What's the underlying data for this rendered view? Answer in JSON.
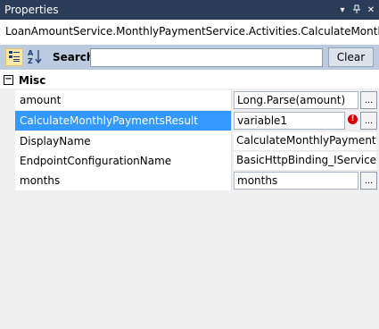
{
  "window": {
    "title": "Properties",
    "icons": [
      "chevron-down-icon",
      "pin-icon",
      "close-icon"
    ]
  },
  "object_selector": {
    "text": "LoanAmountService.MonthlyPaymentService.Activities.CalculateMonthlyPay..."
  },
  "toolbar": {
    "categorized_icon": "categorized-icon",
    "alphabetical_label": "A Z",
    "search_label": "Search:",
    "search_value": "",
    "clear_label": "Clear"
  },
  "grid": {
    "category": "Misc",
    "category_expander": "−",
    "properties": [
      {
        "name": "amount",
        "value": "Long.Parse(amount)",
        "editable": true,
        "selected": false
      },
      {
        "name": "CalculateMonthlyPaymentsResult",
        "value": "variable1",
        "editable": true,
        "selected": true,
        "error": true
      },
      {
        "name": "DisplayName",
        "value": "CalculateMonthlyPayments",
        "editable": false,
        "selected": false
      },
      {
        "name": "EndpointConfigurationName",
        "value": "BasicHttpBinding_IService",
        "editable": false,
        "selected": false
      },
      {
        "name": "months",
        "value": "months",
        "editable": true,
        "selected": false
      }
    ],
    "ellipsis_label": "...",
    "error_glyph": "!"
  },
  "colors": {
    "titlebar": "#2b3c59",
    "toolbar": "#bccbdf",
    "selection": "#3399ff",
    "error": "#d00000"
  }
}
